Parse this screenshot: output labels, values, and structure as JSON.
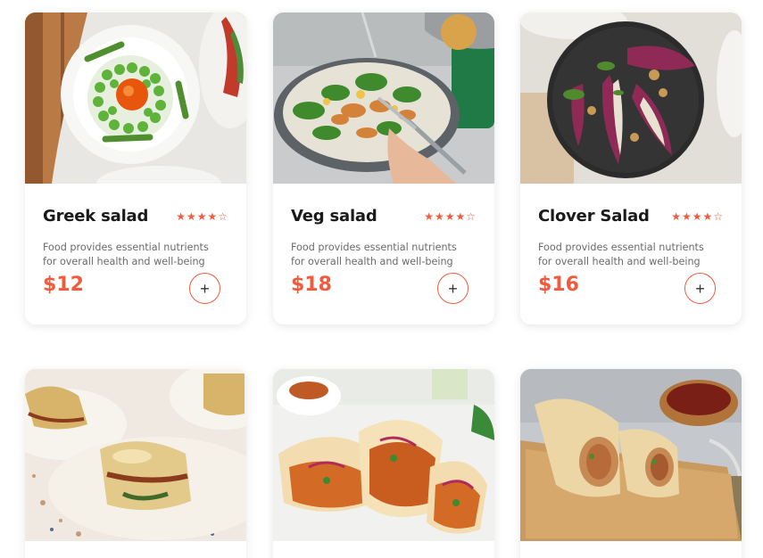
{
  "products": [
    {
      "name": "Greek salad",
      "rating_stars": "★★★★☆",
      "rating": 4,
      "description": "Food provides essential nutrients for overall health and well-being",
      "price": "$12",
      "add_label": "+"
    },
    {
      "name": "Veg salad",
      "rating_stars": "★★★★☆",
      "rating": 4,
      "description": "Food provides essential nutrients for overall health and well-being",
      "price": "$18",
      "add_label": "+"
    },
    {
      "name": "Clover Salad",
      "rating_stars": "★★★★☆",
      "rating": 4,
      "description": "Food provides essential nutrients for overall health and well-being",
      "price": "$16",
      "add_label": "+"
    }
  ],
  "colors": {
    "accent": "#ef5b3c",
    "text": "#1a1a1a",
    "muted": "#6a6a6a"
  }
}
